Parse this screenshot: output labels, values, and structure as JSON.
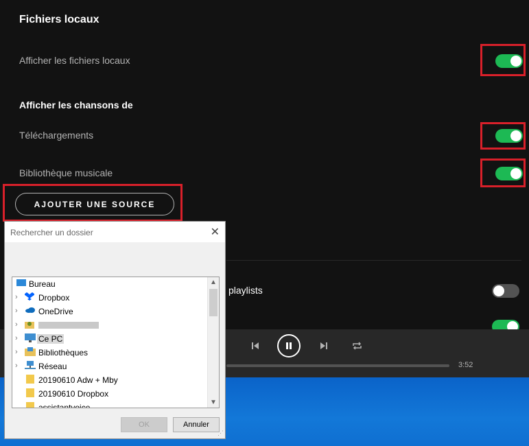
{
  "settings": {
    "section_title": "Fichiers locaux",
    "show_local_label": "Afficher les fichiers locaux",
    "show_songs_title": "Afficher les chansons de",
    "downloads_label": "Téléchargements",
    "music_library_label": "Bibliothèque musicale",
    "add_source_label": "AJOUTER UNE SOURCE",
    "playlists_label": "playlists",
    "toggle_show_local": "on",
    "toggle_downloads": "on",
    "toggle_music_library": "on",
    "toggle_playlists": "off",
    "accent_color": "#1db954",
    "highlight_color": "#d9202a"
  },
  "player": {
    "time_total": "3:52",
    "icons": [
      "shuffle-icon",
      "previous-icon",
      "pause-icon",
      "next-icon",
      "repeat-icon"
    ]
  },
  "dialog": {
    "title": "Rechercher un dossier",
    "items": [
      {
        "label": "Bureau",
        "icon": "desktop-icon"
      },
      {
        "label": "Dropbox",
        "icon": "dropbox-icon"
      },
      {
        "label": "OneDrive",
        "icon": "onedrive-icon"
      },
      {
        "label": "",
        "icon": "user-folder-icon"
      },
      {
        "label": "Ce PC",
        "icon": "computer-icon"
      },
      {
        "label": "Bibliothèques",
        "icon": "libraries-icon"
      },
      {
        "label": "Réseau",
        "icon": "network-icon"
      },
      {
        "label": "20190610 Adw + Mby",
        "icon": "folder-icon"
      },
      {
        "label": "20190610 Dropbox",
        "icon": "folder-icon"
      },
      {
        "label": "assistantvoice",
        "icon": "folder-icon"
      }
    ],
    "ok_label": "OK",
    "cancel_label": "Annuler"
  }
}
